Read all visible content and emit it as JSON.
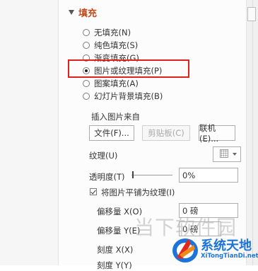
{
  "fill_section": {
    "title": "填充"
  },
  "fill_options": [
    {
      "label": "无填充(N)",
      "selected": false
    },
    {
      "label": "纯色填充(S)",
      "selected": false
    },
    {
      "label": "渐变填充(G)",
      "selected": false
    },
    {
      "label": "图片或纹理填充(P)",
      "selected": true
    },
    {
      "label": "图案填充(A)",
      "selected": false
    },
    {
      "label": "幻灯片背景填充(B)",
      "selected": false
    }
  ],
  "insert_picture": {
    "label": "插入图片来自",
    "file_button": "文件(F)...",
    "clipboard_button": "剪贴板(C)",
    "online_button": "联机(E)..."
  },
  "texture": {
    "label": "纹理(U)"
  },
  "transparency": {
    "label": "透明度(T)",
    "value": "0%"
  },
  "tile_checkbox": {
    "label": "将图片平铺为纹理(I)",
    "checked": true
  },
  "offset_x": {
    "label": "偏移量 X(O)",
    "value": "0 磅"
  },
  "offset_y": {
    "label": "偏移量 Y(E)",
    "value": "0 磅"
  },
  "scale_x": {
    "label": "刻度 X(X)"
  },
  "scale_y": {
    "label": "刻度 Y(Y)"
  },
  "watermark": {
    "text": "当下软件园"
  },
  "logo": {
    "title": "系统天地",
    "subtitle": "XiTongTianDi.net"
  },
  "colors": {
    "accent": "#c14a1a",
    "highlight": "#e0201a",
    "logo_blue": "#1e73d8"
  }
}
